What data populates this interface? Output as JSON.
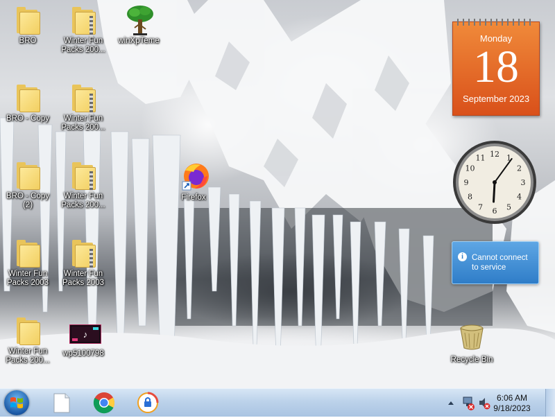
{
  "desktop": {
    "icons": [
      {
        "label": "BRO",
        "kind": "folder"
      },
      {
        "label": "BRO - Copy",
        "kind": "folder"
      },
      {
        "label": "BRO - Copy\n(2)",
        "kind": "folder"
      },
      {
        "label": "Winter Fun\nPacks 2003",
        "kind": "folder"
      },
      {
        "label": "Winter Fun\nPacks 200...",
        "kind": "folder"
      },
      {
        "label": "Winter Fun\nPacks 200...",
        "kind": "zip-folder"
      },
      {
        "label": "Winter Fun\nPacks 200...",
        "kind": "zip-folder"
      },
      {
        "label": "Winter Fun\nPacks 200...",
        "kind": "zip-folder"
      },
      {
        "label": "Winter Fun\nPacks 2003",
        "kind": "zip-folder"
      },
      {
        "label": "wp5100798",
        "kind": "image-file"
      },
      {
        "label": "winXpTeme",
        "kind": "tree-icon"
      },
      {
        "label": "Firefox",
        "kind": "firefox-shortcut"
      },
      {
        "label": "Recycle Bin",
        "kind": "recycle-bin"
      }
    ]
  },
  "gadgets": {
    "calendar": {
      "day": "Monday",
      "date": "18",
      "month_year": "September 2023"
    },
    "clock": {
      "hours": 6,
      "minutes": 6,
      "numerals": [
        "12",
        "1",
        "2",
        "3",
        "4",
        "5",
        "6",
        "7",
        "8",
        "9",
        "10",
        "11"
      ]
    },
    "service": {
      "message_line1": "Cannot connect",
      "message_line2": "to service",
      "icon": "info-icon"
    }
  },
  "taskbar": {
    "pinned": [
      {
        "name": "blank-document",
        "icon": "document-icon"
      },
      {
        "name": "chrome",
        "icon": "chrome-icon"
      },
      {
        "name": "vpn-app",
        "icon": "lock-icon"
      }
    ],
    "tray": {
      "time": "6:06 AM",
      "date": "9/18/2023",
      "icons": [
        "show-hidden-icons-arrow",
        "network-icon",
        "volume-muted-icon"
      ]
    }
  },
  "colors": {
    "calendar_orange": "#e2672a",
    "folder_yellow": "#f2cf61",
    "taskbar_blue": "#bcd2ea",
    "balloon_blue": "#3d8bd2"
  }
}
